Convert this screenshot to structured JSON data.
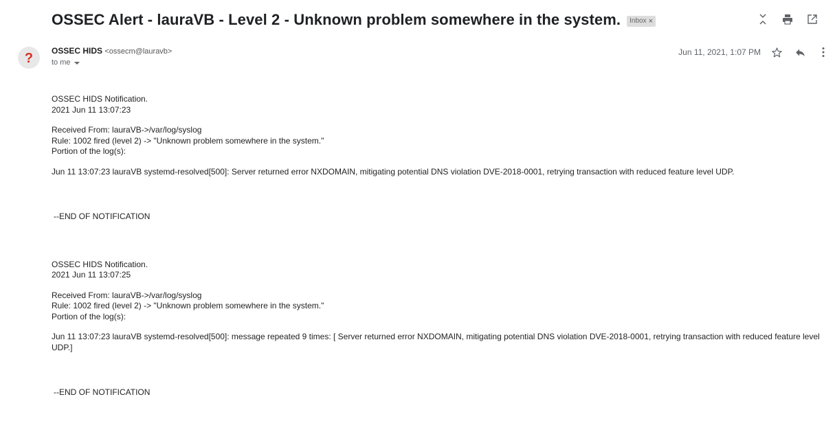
{
  "header": {
    "subject": "OSSEC Alert - lauraVB - Level 2 - Unknown problem somewhere in the system.",
    "label": "Inbox",
    "label_remove": "×",
    "icons": [
      "expand-collapse-icon",
      "print-icon",
      "open-new-window-icon"
    ]
  },
  "message": {
    "avatar_text": "?",
    "sender_name": "OSSEC HIDS",
    "sender_email": "<ossecm@lauravb>",
    "to_line": "to me",
    "date": "Jun 11, 2021, 1:07 PM",
    "icons": [
      "star-icon",
      "reply-icon",
      "more-vert-icon"
    ]
  },
  "notifications": [
    {
      "title": "OSSEC HIDS Notification.",
      "timestamp": "2021 Jun 11 13:07:23",
      "received": "Received From: lauraVB->/var/log/syslog",
      "rule": "Rule: 1002 fired (level 2) -> \"Unknown problem somewhere in the system.\"",
      "portion": "Portion of the log(s):",
      "log": "Jun 11 13:07:23 lauraVB systemd-resolved[500]: Server returned error NXDOMAIN, mitigating potential DNS violation DVE-2018-0001, retrying transaction with reduced feature level UDP.",
      "end": "--END OF NOTIFICATION"
    },
    {
      "title": "OSSEC HIDS Notification.",
      "timestamp": "2021 Jun 11 13:07:25",
      "received": "Received From: lauraVB->/var/log/syslog",
      "rule": "Rule: 1002 fired (level 2) -> \"Unknown problem somewhere in the system.\"",
      "portion": "Portion of the log(s):",
      "log": "Jun 11 13:07:23 lauraVB systemd-resolved[500]: message repeated 9 times: [ Server returned error NXDOMAIN, mitigating potential DNS violation DVE-2018-0001, retrying transaction with reduced feature level UDP.]",
      "end": "--END OF NOTIFICATION"
    }
  ],
  "colors": {
    "avatar_bg": "#ffffff",
    "avatar_fill": "#e8e8e8",
    "avatar_mark": "#d93025",
    "icon": "#5f6368",
    "label_bg": "#dddddd"
  }
}
